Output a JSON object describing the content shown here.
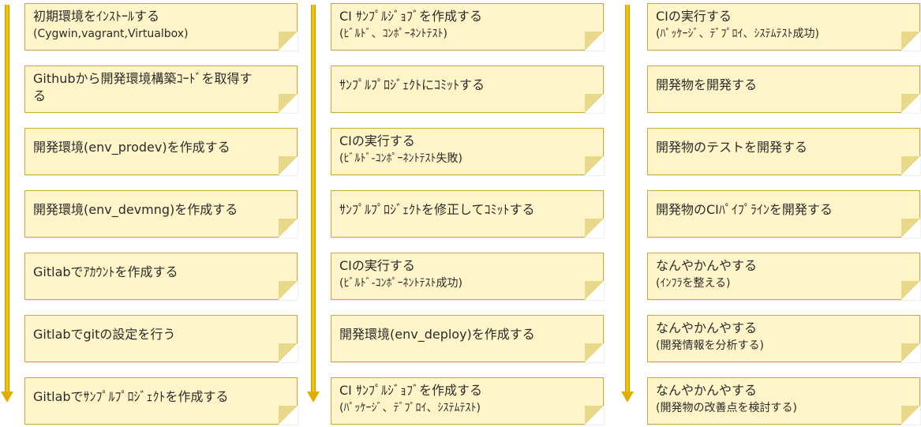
{
  "columns": [
    {
      "steps": [
        {
          "line1": "初期環境をｲﾝｽﾄｰﾙする",
          "line2": "(Cygwin,vagrant,Virtualbox)"
        },
        {
          "line1": "Githubから開発環境構築ｺｰﾄﾞを取得す",
          "line2": "る"
        },
        {
          "line1": "開発環境(env_prodev)を作成する",
          "line2": ""
        },
        {
          "line1": "開発環境(env_devmng)を作成する",
          "line2": ""
        },
        {
          "line1": "Gitlabでｱｶｳﾝﾄを作成する",
          "line2": ""
        },
        {
          "line1": "Gitlabでgitの設定を行う",
          "line2": ""
        },
        {
          "line1": "Gitlabでｻﾝﾌﾟﾙﾌﾟﾛｼﾞｪｸﾄを作成する",
          "line2": ""
        }
      ]
    },
    {
      "steps": [
        {
          "line1": "CI ｻﾝﾌﾟﾙｼﾞｮﾌﾞを作成する",
          "line2": "(ﾋﾞﾙﾄﾞ、ｺﾝﾎﾟｰﾈﾝﾄﾃｽﾄ)"
        },
        {
          "line1": "ｻﾝﾌﾟﾙﾌﾟﾛｼﾞｪｸﾄにｺﾐｯﾄする",
          "line2": ""
        },
        {
          "line1": "CIの実行する",
          "line2": "(ﾋﾞﾙﾄﾞ-ｺﾝﾎﾟｰﾈﾝﾄﾃｽﾄ失敗)"
        },
        {
          "line1": "ｻﾝﾌﾟﾙﾌﾟﾛｼﾞｪｸﾄを修正してｺﾐｯﾄする",
          "line2": ""
        },
        {
          "line1": "CIの実行する",
          "line2": "(ﾋﾞﾙﾄﾞ-ｺﾝﾎﾟｰﾈﾝﾄﾃｽﾄ成功)"
        },
        {
          "line1": "開発環境(env_deploy)を作成する",
          "line2": ""
        },
        {
          "line1": "CI ｻﾝﾌﾟﾙｼﾞｮﾌﾞを作成する",
          "line2": "(ﾊﾟｯｹｰｼﾞ、ﾃﾞﾌﾟﾛｲ、ｼｽﾃﾑﾃｽﾄ)"
        }
      ]
    },
    {
      "steps": [
        {
          "line1": "CIの実行する",
          "line2": "(ﾊﾟｯｹｰｼﾞ、ﾃﾞﾌﾟﾛｲ、ｼｽﾃﾑﾃｽﾄ成功)"
        },
        {
          "line1": "開発物を開発する",
          "line2": ""
        },
        {
          "line1": "開発物のテストを開発する",
          "line2": ""
        },
        {
          "line1": "開発物のCIﾊﾟｲﾌﾟﾗｲﾝを開発する",
          "line2": ""
        },
        {
          "line1": "なんやかんやする",
          "line2": "(ｲﾝﾌﾗを整える)"
        },
        {
          "line1": "なんやかんやする",
          "line2": "(開発情報を分析する)"
        },
        {
          "line1": "なんやかんやする",
          "line2": "(開発物の改善点を検討する)"
        }
      ]
    }
  ],
  "colors": {
    "note_fill": "#fff5c8",
    "note_border": "#c9a93a",
    "arrow": "#f2c200"
  }
}
